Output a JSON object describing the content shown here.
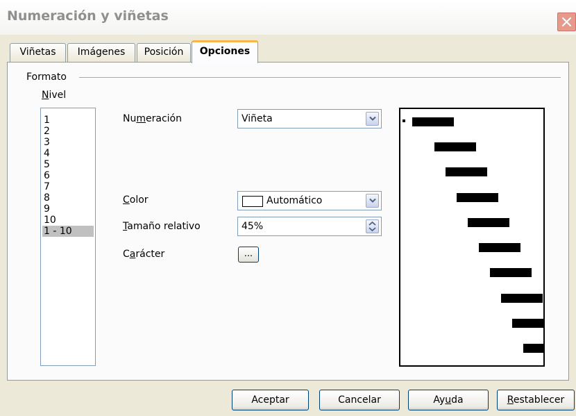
{
  "window": {
    "title": "Numeración y viñetas"
  },
  "tabs": [
    {
      "label": "Viñetas",
      "active": false
    },
    {
      "label": "Imágenes",
      "active": false
    },
    {
      "label": "Posición",
      "active": false
    },
    {
      "label": "Opciones",
      "active": true
    }
  ],
  "format": {
    "group_label": "Formato",
    "level_label": "Nivel",
    "levels": [
      "1",
      "2",
      "3",
      "4",
      "5",
      "6",
      "7",
      "8",
      "9",
      "10",
      "1 - 10"
    ],
    "selected_level": "1 - 10"
  },
  "options": {
    "numbering_label": "Numeración",
    "numbering_value": "Viñeta",
    "color_label": "Color",
    "color_value": "Automático",
    "relative_size_label": "Tamaño relativo",
    "relative_size_value": "45%",
    "character_label": "Carácter",
    "character_button": "..."
  },
  "buttons": {
    "ok": "Aceptar",
    "cancel": "Cancelar",
    "help": "Ayuda",
    "reset": "Restablecer"
  },
  "icons": {
    "close": "close-icon",
    "dropdown": "chevron-down-icon",
    "spin": "spin-updown-icon"
  },
  "colors": {
    "active_tab_accent": "#f6b54a",
    "close_button": "#e8998a",
    "dialog_background": "#ece9d8",
    "selection": "#c0c0c0"
  }
}
